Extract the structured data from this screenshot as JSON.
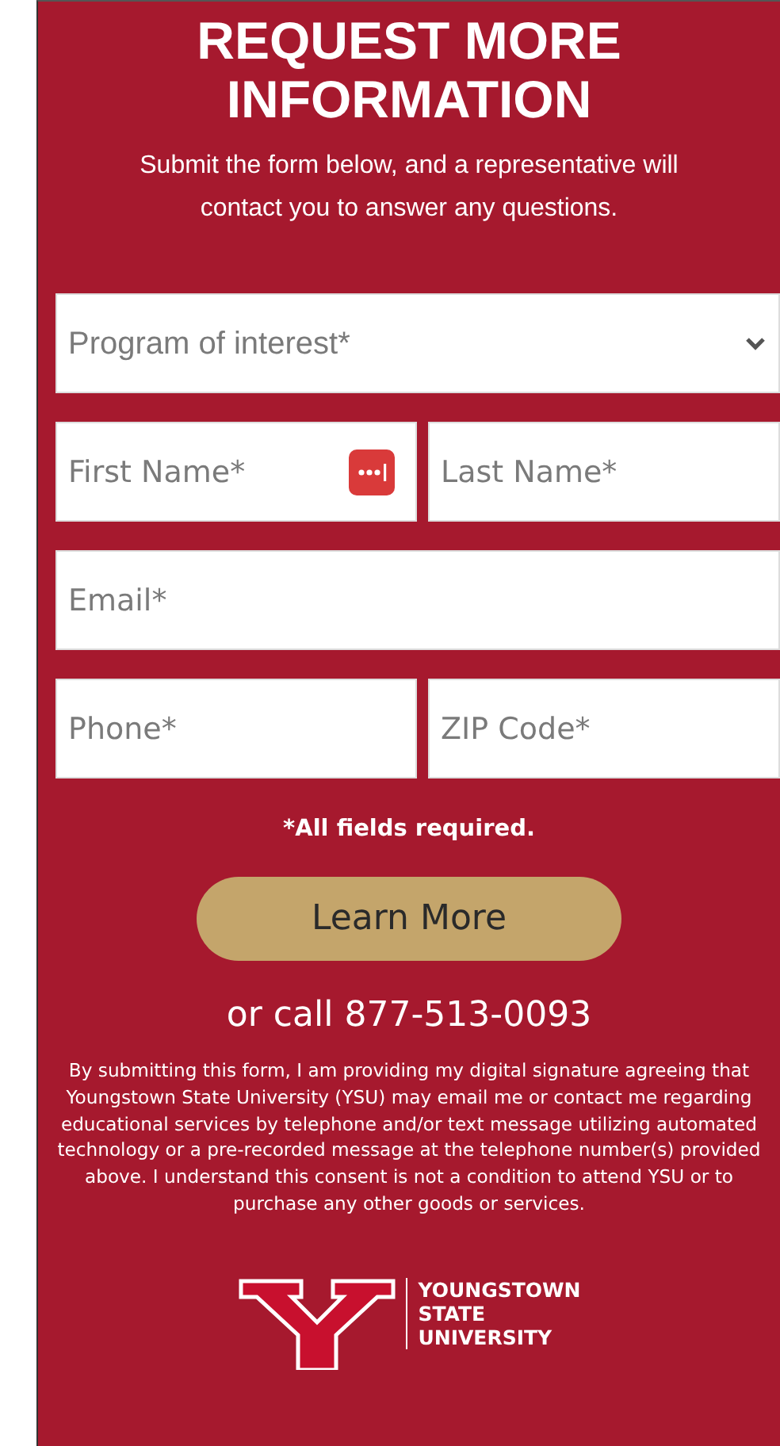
{
  "heading": "REQUEST MORE INFORMATION",
  "intro": "Submit the form below, and a representative will contact you to answer any questions.",
  "field_rows": [
    [
      {
        "kind": "select",
        "placeholder": "Program of interest*"
      }
    ],
    [
      {
        "kind": "text",
        "placeholder": "First Name*",
        "autofill_icon": true
      },
      {
        "kind": "text",
        "placeholder": "Last Name*",
        "autofill_icon": false
      }
    ],
    [
      {
        "kind": "text",
        "placeholder": "Email*",
        "autofill_icon": false
      }
    ],
    [
      {
        "kind": "text",
        "placeholder": "Phone*",
        "autofill_icon": false
      },
      {
        "kind": "text",
        "placeholder": "ZIP Code*",
        "autofill_icon": false
      }
    ]
  ],
  "required_note": "*All fields required.",
  "submit_button": "Learn More",
  "call_text": "or call 877-513-0093",
  "disclaimer": "By submitting this form, I am providing my digital signature agreeing that Youngstown State University (YSU) may email me or contact me regarding educational services by telephone and/or text message utilizing automated technology or a pre-recorded message at the telephone number(s) provided above. I understand this consent is not a condition to attend YSU or to purchase any other goods or services.",
  "logo_lines": [
    "YOUNGSTOWN",
    "STATE",
    "UNIVERSITY"
  ]
}
